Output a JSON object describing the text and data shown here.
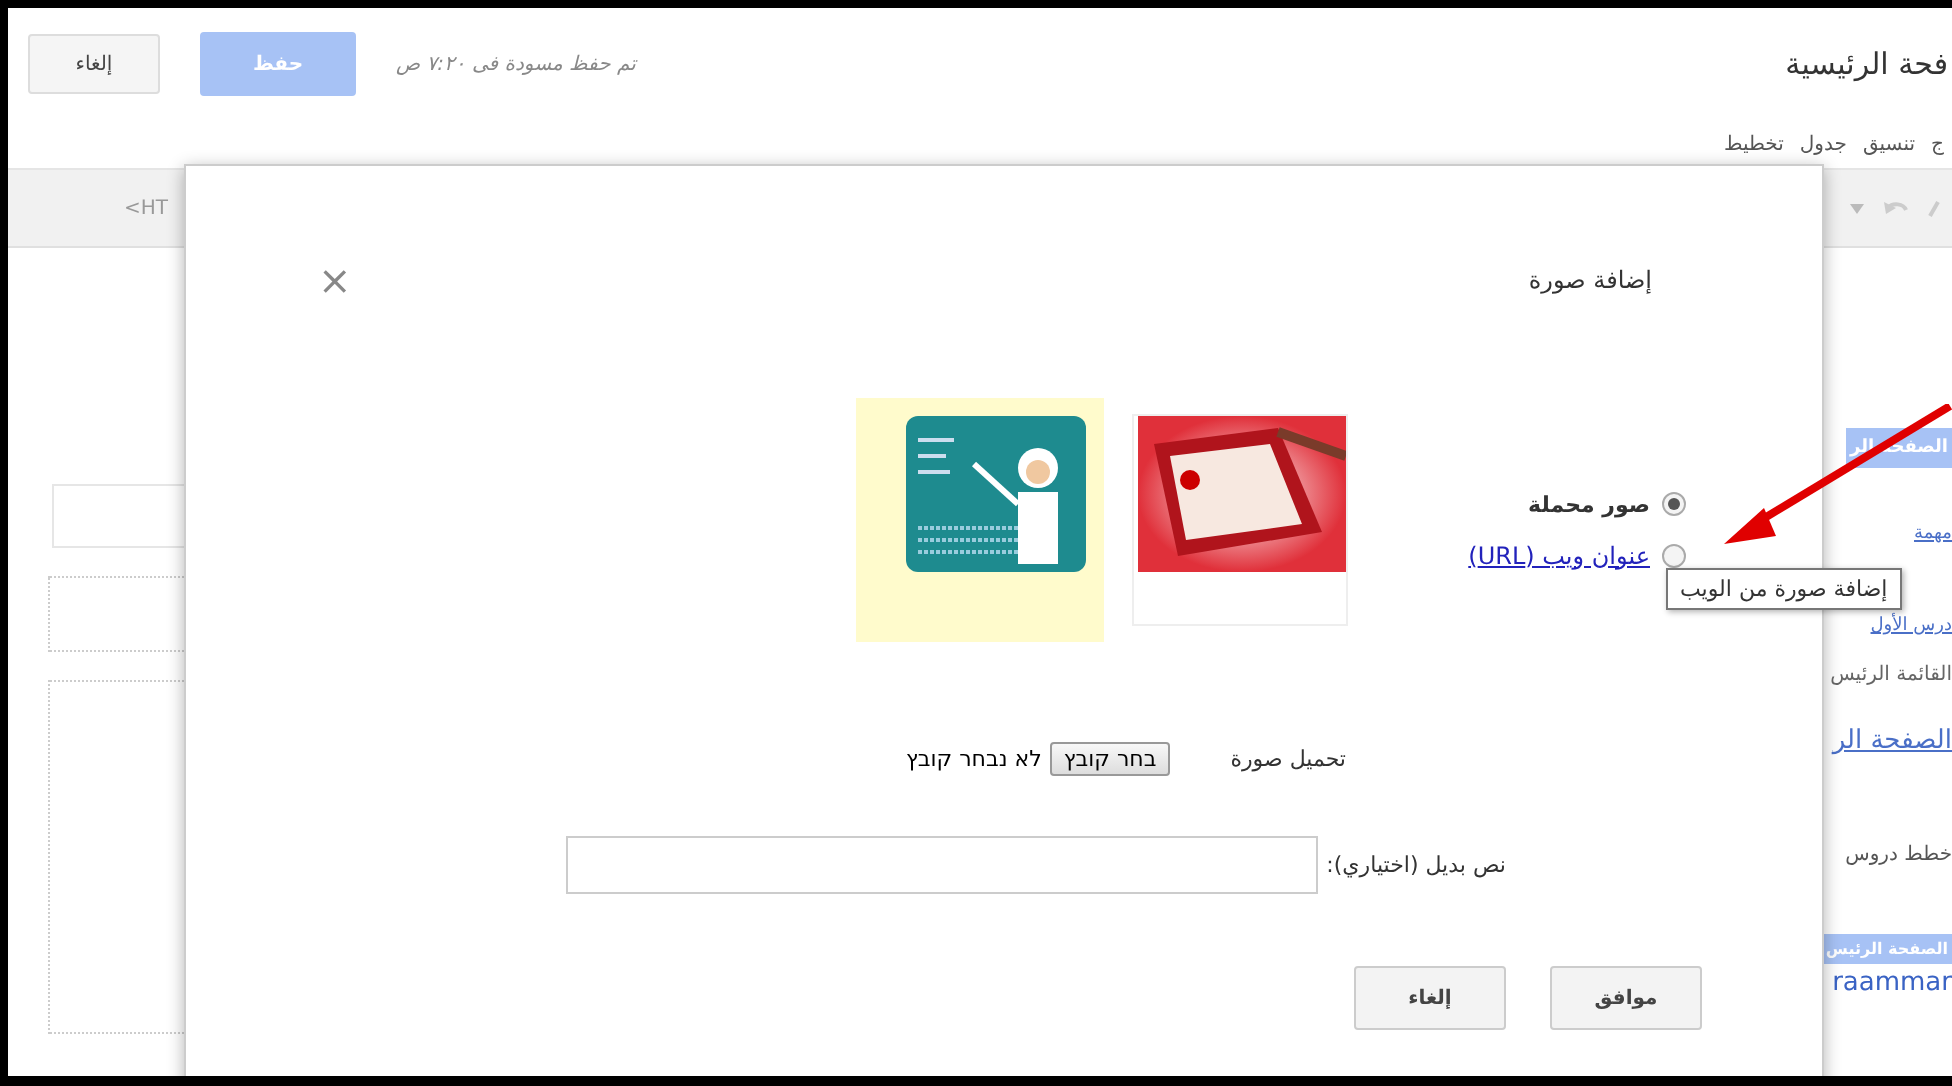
{
  "editor": {
    "cancel_button": "إلغاء",
    "save_button": "حفظ",
    "draft_status": "تم حفظ مسودة فى ٧:٢٠ ص",
    "page_title": "فحة الرئيسية",
    "menu": [
      "ج",
      "تنسيق",
      "جدول",
      "تخطيط"
    ],
    "html_label": "<HT"
  },
  "sidebar": [
    {
      "kind": "button",
      "label": "الصفحة الر"
    },
    {
      "kind": "link",
      "label": "مهمة"
    },
    {
      "kind": "link",
      "label": "درس الأول"
    },
    {
      "kind": "text",
      "label": "القائمة الرئيس"
    },
    {
      "kind": "link",
      "label": "الصفحة الر"
    },
    {
      "kind": "heading",
      "label": "خطط دروس"
    },
    {
      "kind": "header",
      "label": "الصفحة الرئيس"
    },
    {
      "kind": "text",
      "label": "raammar"
    }
  ],
  "dialog": {
    "title": "إضافة صورة",
    "close": "×",
    "sources": [
      {
        "kind": "text",
        "label": "صور محملة",
        "selected": true
      },
      {
        "kind": "link",
        "label": "عنوان ويب (URL)",
        "selected": false
      }
    ],
    "tooltip": "إضافة صورة من الويب",
    "thumbnails": [
      {
        "kind": "frame",
        "selected": false
      },
      {
        "kind": "cartoon",
        "selected": true
      }
    ],
    "upload_label": "تحميل صورة",
    "choose_file_button": "בחר קובץ",
    "file_status": "לא נבחר קובץ",
    "alt_text_label": "نص بديل (اختياري):",
    "ok_button": "موافق",
    "cancel_button": "إلغاء"
  }
}
